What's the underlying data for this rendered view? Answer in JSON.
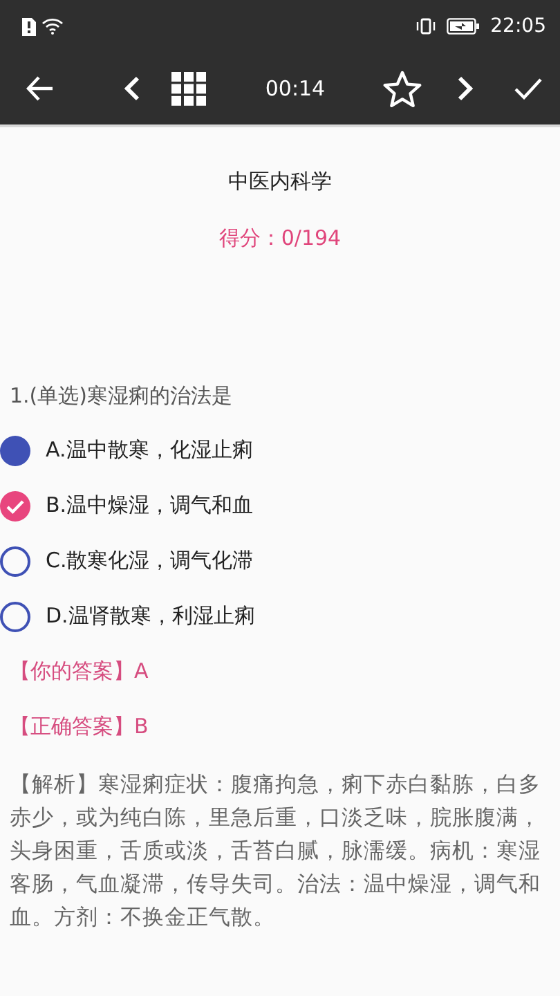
{
  "status_bar": {
    "time": "22:05"
  },
  "toolbar": {
    "timer": "00:14",
    "favorited": false
  },
  "title": "中医内科学",
  "score": "得分：0/194",
  "question": "1.(单选)寒湿痢的治法是",
  "options": [
    {
      "label": "A.温中散寒，化湿止痢",
      "kind": "chosen"
    },
    {
      "label": "B.温中燥湿，调气和血",
      "kind": "correct"
    },
    {
      "label": "C.散寒化湿，调气化滞",
      "kind": "empty"
    },
    {
      "label": "D.温肾散寒，利湿止痢",
      "kind": "empty"
    }
  ],
  "your_answer": "【你的答案】A",
  "correct_answer": "【正确答案】B",
  "analysis": "【解析】寒湿痢症状：腹痛拘急，痢下赤白黏胨，白多赤少，或为纯白陈，里急后重，口淡乏味，脘胀腹满，头身困重，舌质或淡，舌苔白腻，脉濡缓。病机：寒湿客肠，气血凝滞，传导失司。治法：温中燥湿，调气和血。方剂：不换金正气散。"
}
